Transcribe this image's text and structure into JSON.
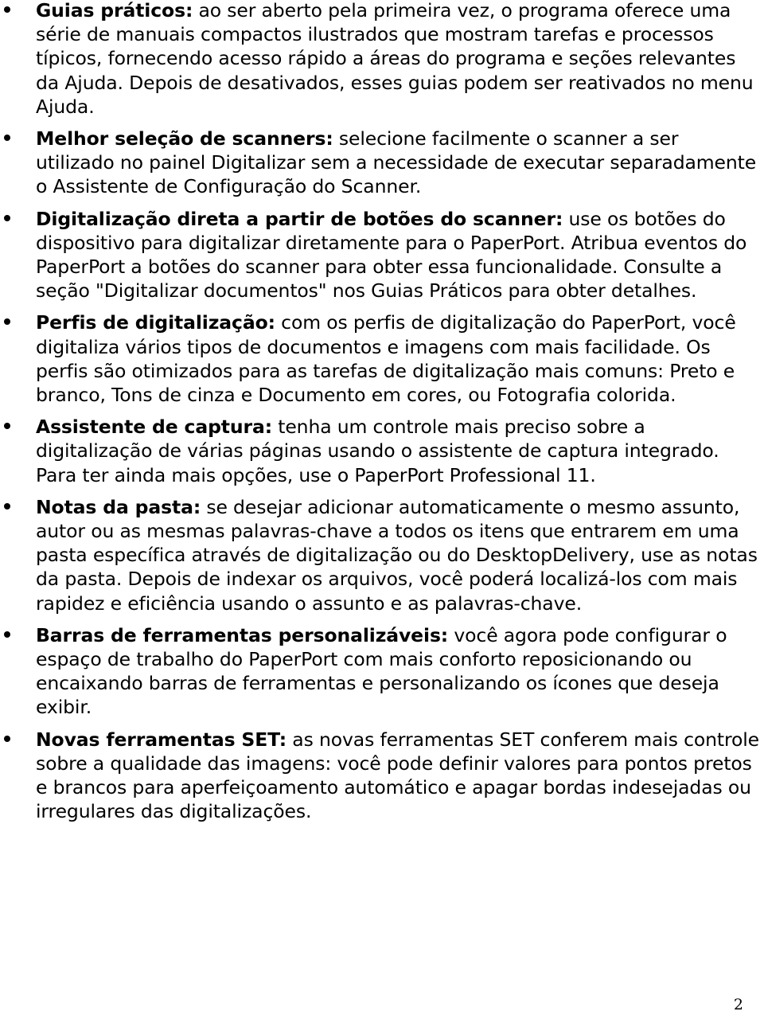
{
  "document": {
    "page_number": "2",
    "bullets": [
      {
        "lead": "Guias práticos:",
        "body": " ao ser aberto pela primeira vez, o programa oferece uma série de manuais compactos ilustrados que mostram tarefas e processos típicos, fornecendo acesso rápido a áreas do programa e seções relevantes da Ajuda. Depois de desativados, esses guias podem ser reativados no menu Ajuda."
      },
      {
        "lead": "Melhor seleção de scanners:",
        "body": " selecione facilmente o scanner a ser utilizado no painel Digitalizar sem a necessidade de executar separadamente o Assistente de Configuração do Scanner."
      },
      {
        "lead": "Digitalização direta a partir de botões do scanner:",
        "body": " use os botões do dispositivo para digitalizar diretamente para o PaperPort. Atribua eventos do PaperPort a botões do scanner para obter essa funcionalidade. Consulte a seção \"Digitalizar documentos\" nos Guias Práticos para obter detalhes."
      },
      {
        "lead": "Perfis de digitalização:",
        "body": " com os perfis de digitalização do PaperPort, você digitaliza vários tipos de documentos e imagens com mais facilidade. Os perfis são otimizados para as tarefas de digitalização mais comuns: Preto e branco, Tons de cinza e Documento em cores, ou Fotografia colorida."
      },
      {
        "lead": "Assistente de captura:",
        "body": " tenha um controle mais preciso sobre a digitalização de várias páginas usando o assistente de captura integrado. Para ter ainda mais opções, use o PaperPort Professional 11."
      },
      {
        "lead": "Notas da pasta:",
        "body": " se desejar adicionar automaticamente o mesmo assunto, autor ou as mesmas palavras-chave a todos os itens que entrarem em uma pasta específica através de digitalização ou do DesktopDelivery, use as notas da pasta. Depois de indexar os arquivos, você poderá localizá-los com mais rapidez e eficiência usando o assunto e as palavras-chave."
      },
      {
        "lead": "Barras de ferramentas personalizáveis:",
        "body": " você agora pode configurar o espaço de trabalho do PaperPort com mais conforto reposicionando ou encaixando barras de ferramentas e personalizando os ícones que deseja exibir."
      },
      {
        "lead": "Novas ferramentas SET:",
        "body": " as novas ferramentas SET conferem mais controle sobre a qualidade das imagens: você pode definir valores para pontos pretos e brancos para aperfeiçoamento automático e apagar bordas indesejadas ou irregulares das digitalizações."
      }
    ]
  }
}
